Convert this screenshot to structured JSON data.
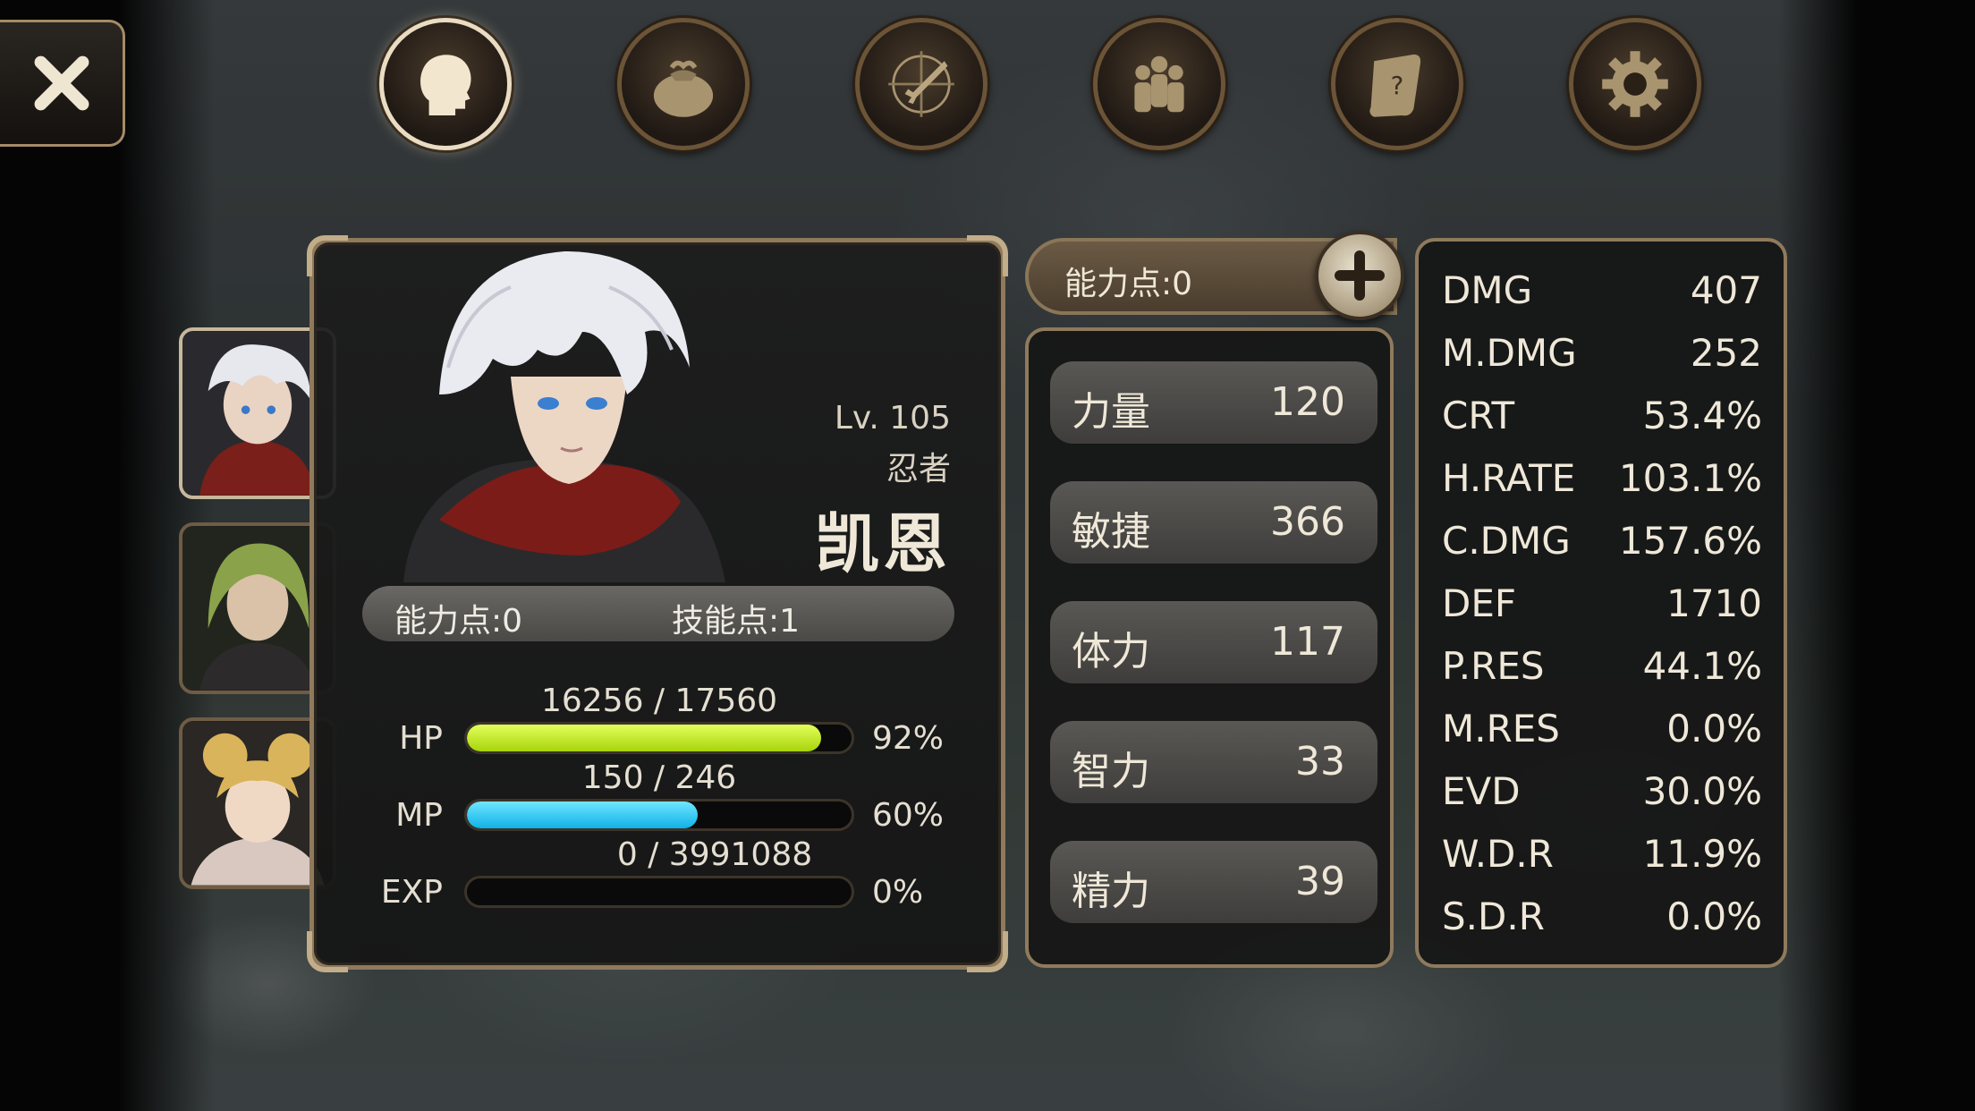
{
  "nav": {
    "close_icon": "close-icon",
    "tabs": [
      {
        "name": "character-tab",
        "icon": "head-icon",
        "active": true
      },
      {
        "name": "inventory-tab",
        "icon": "bag-icon",
        "active": false
      },
      {
        "name": "skills-tab",
        "icon": "sword-compass-icon",
        "active": false
      },
      {
        "name": "party-tab",
        "icon": "people-icon",
        "active": false
      },
      {
        "name": "quest-tab",
        "icon": "scroll-icon",
        "active": false
      },
      {
        "name": "settings-tab",
        "icon": "gear-icon",
        "active": false
      }
    ]
  },
  "character": {
    "level": "Lv. 105",
    "class": "忍者",
    "name": "凯恩",
    "ability_points": "能力点:0",
    "skill_points": "技能点:1",
    "hp": {
      "label": "HP",
      "value": "16256 / 17560",
      "percent": "92%",
      "fraction": 0.92
    },
    "mp": {
      "label": "MP",
      "value": "150 / 246",
      "percent": "60%",
      "fraction": 0.6
    },
    "exp": {
      "label": "EXP",
      "value": "0 / 3991088",
      "percent": "0%",
      "fraction": 0
    }
  },
  "attributes": {
    "header": "能力点:0",
    "items": [
      {
        "name": "力量",
        "value": "120"
      },
      {
        "name": "敏捷",
        "value": "366"
      },
      {
        "name": "体力",
        "value": "117"
      },
      {
        "name": "智力",
        "value": "33"
      },
      {
        "name": "精力",
        "value": "39"
      }
    ]
  },
  "stats": [
    {
      "name": "DMG",
      "value": "407"
    },
    {
      "name": "M.DMG",
      "value": "252"
    },
    {
      "name": "CRT",
      "value": "53.4%"
    },
    {
      "name": "H.RATE",
      "value": "103.1%"
    },
    {
      "name": "C.DMG",
      "value": "157.6%"
    },
    {
      "name": "DEF",
      "value": "1710"
    },
    {
      "name": "P.RES",
      "value": "44.1%"
    },
    {
      "name": "M.RES",
      "value": "0.0%"
    },
    {
      "name": "EVD",
      "value": "30.0%"
    },
    {
      "name": "W.D.R",
      "value": "11.9%"
    },
    {
      "name": "S.D.R",
      "value": "0.0%"
    }
  ],
  "colors": {
    "hp": "#c4f01c",
    "mp": "#1ec8f0",
    "accent": "#8f7a5c"
  }
}
